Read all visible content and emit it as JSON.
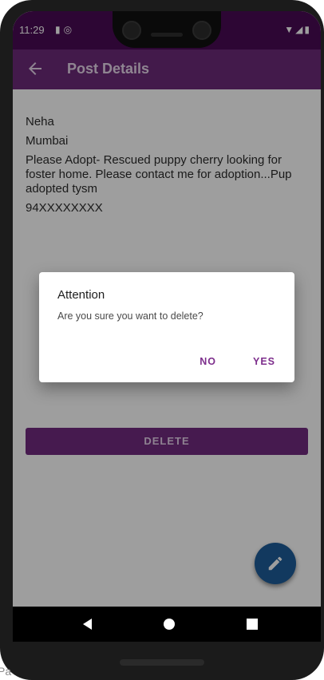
{
  "status_bar": {
    "time": "11:29",
    "left_icons": [
      "sd-card-icon",
      "sync-icon"
    ],
    "right_icons": [
      "wifi-icon",
      "signal-icon",
      "battery-icon"
    ]
  },
  "app_bar": {
    "title": "Post Details",
    "back_icon": "arrow-left-icon"
  },
  "post": {
    "name": "Neha",
    "city": "Mumbai",
    "description": "Please Adopt- Rescued puppy cherry looking for foster home. Please contact me for adoption...Pup adopted tysm",
    "phone": "94XXXXXXXX"
  },
  "actions": {
    "delete_label": "DELETE",
    "fab_icon": "pencil-icon"
  },
  "dialog": {
    "title": "Attention",
    "message": "Are you sure you want to delete?",
    "no_label": "NO",
    "yes_label": "YES"
  },
  "nav_bar": {
    "icons": [
      "back-triangle-icon",
      "home-circle-icon",
      "recents-square-icon"
    ]
  },
  "colors": {
    "status_bar": "#4a0a54",
    "app_bar": "#6c2a7a",
    "accent": "#722b80",
    "fab": "#1d5d9a"
  },
  "corner_fragment": "Pa"
}
